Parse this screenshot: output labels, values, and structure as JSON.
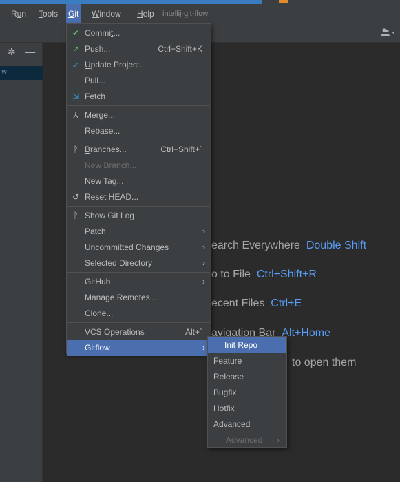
{
  "menubar": {
    "items": [
      {
        "label": "Run",
        "mnemonic": "u"
      },
      {
        "label": "Tools",
        "mnemonic": "T"
      },
      {
        "label": "Git",
        "mnemonic": "G"
      },
      {
        "label": "Window",
        "mnemonic": "W"
      },
      {
        "label": "Help",
        "mnemonic": "H"
      }
    ],
    "project_title": "intellij-git-flow"
  },
  "icons": {
    "user": "user-dropdown-icon",
    "gear": "gear-icon",
    "minimize": "minimize-icon"
  },
  "git_menu": {
    "items": [
      {
        "label": "Commit...",
        "icon": "check-icon",
        "icon_color": "#5fb85f"
      },
      {
        "label": "Push...",
        "shortcut": "Ctrl+Shift+K",
        "icon": "push-arrow-icon",
        "icon_color": "#5fb85f"
      },
      {
        "label": "Update Project...",
        "icon": "update-arrow-icon",
        "icon_color": "#3592c4"
      },
      {
        "label": "Pull..."
      },
      {
        "label": "Fetch",
        "icon": "fetch-icon",
        "icon_color": "#3592c4"
      },
      {
        "label": "Merge...",
        "icon": "merge-icon"
      },
      {
        "label": "Rebase..."
      },
      {
        "label": "Branches...",
        "shortcut": "Ctrl+Shift+`",
        "icon": "branch-icon"
      },
      {
        "label": "New Branch...",
        "disabled": true
      },
      {
        "label": "New Tag..."
      },
      {
        "label": "Reset HEAD...",
        "icon": "reset-icon"
      },
      {
        "label": "Show Git Log",
        "icon": "git-log-icon"
      },
      {
        "label": "Patch",
        "submenu": true
      },
      {
        "label": "Uncommitted Changes",
        "submenu": true
      },
      {
        "label": "Selected Directory",
        "submenu": true
      },
      {
        "label": "GitHub",
        "submenu": true
      },
      {
        "label": "Manage Remotes..."
      },
      {
        "label": "Clone..."
      },
      {
        "label": "VCS Operations",
        "shortcut": "Alt+`"
      },
      {
        "label": "Gitflow",
        "submenu": true,
        "active": true
      }
    ]
  },
  "gitflow_submenu": {
    "items": [
      {
        "label": "Init Repo",
        "active": true
      },
      {
        "label": "Feature"
      },
      {
        "label": "Release"
      },
      {
        "label": "Bugfix"
      },
      {
        "label": "Hotfix"
      },
      {
        "label": "Advanced"
      },
      {
        "label": "Advanced",
        "disabled": true,
        "submenu": true
      }
    ]
  },
  "editor_hints": [
    {
      "text": "earch Everywhere",
      "key": "Double Shift"
    },
    {
      "text": "o to File",
      "key": "Ctrl+Shift+R"
    },
    {
      "text": "ecent Files",
      "key": "Ctrl+E"
    },
    {
      "text": "avigation Bar",
      "key": "Alt+Home"
    },
    {
      "text": "to open them",
      "key": ""
    }
  ],
  "colors": {
    "accent": "#4b6eaf",
    "menu_bg": "#3c3f41",
    "editor_bg": "#2b2b2b",
    "hint_key": "#589df6"
  }
}
